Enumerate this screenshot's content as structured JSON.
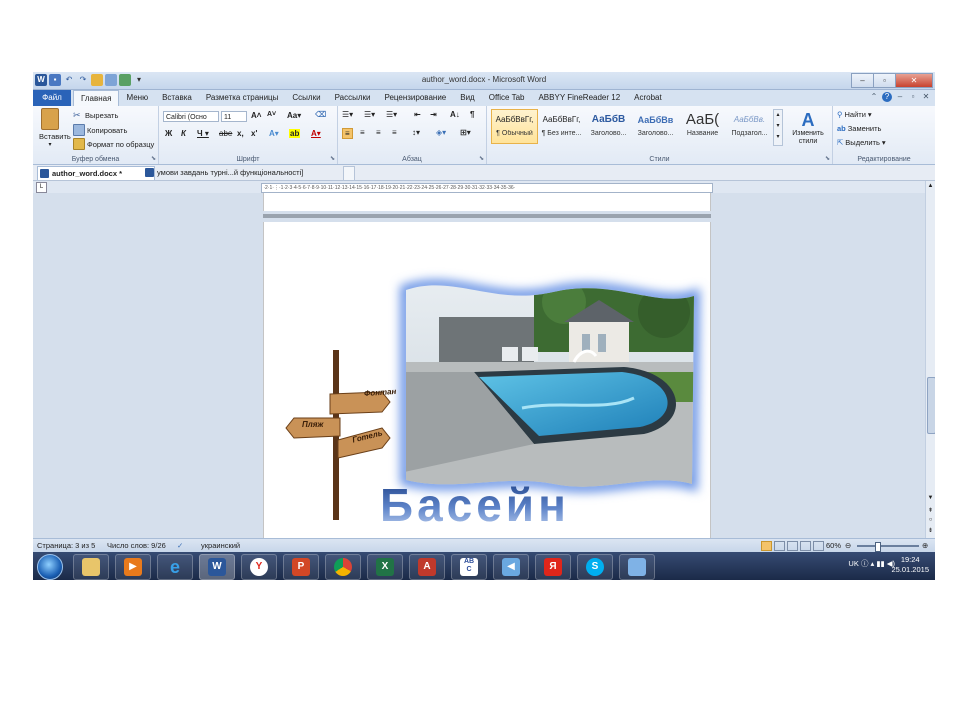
{
  "window": {
    "title": "author_word.docx - Microsoft Word",
    "quick_access_icons": [
      "word-logo",
      "save-icon",
      "undo-icon",
      "redo-icon",
      "misc-icon"
    ]
  },
  "ribbon_tabs": {
    "file": "Файл",
    "tabs": [
      "Главная",
      "Меню",
      "Вставка",
      "Разметка страницы",
      "Ссылки",
      "Рассылки",
      "Рецензирование",
      "Вид",
      "Office Tab",
      "ABBYY FineReader 12",
      "Acrobat"
    ],
    "active_index": 0
  },
  "clipboard": {
    "paste": "Вставить",
    "cut": "Вырезать",
    "copy": "Копировать",
    "format_painter": "Формат по образцу",
    "label": "Буфер обмена"
  },
  "font": {
    "name": "Calibri (Осно",
    "size": "11",
    "label": "Шрифт"
  },
  "paragraph": {
    "label": "Абзац"
  },
  "styles": {
    "label": "Стили",
    "items": [
      {
        "preview": "АаБбВвГг,",
        "name": "¶ Обычный"
      },
      {
        "preview": "АаБбВвГг,",
        "name": "¶ Без инте..."
      },
      {
        "preview": "АаБбВ",
        "name": "Заголово..."
      },
      {
        "preview": "АаБбВв",
        "name": "Заголово..."
      },
      {
        "preview": "АаБ(",
        "name": "Название"
      },
      {
        "preview": "АаБбВв.",
        "name": "Подзагол..."
      }
    ],
    "change": "Изменить стили"
  },
  "editing": {
    "find": "Найти",
    "replace": "Заменить",
    "select": "Выделить",
    "label": "Редактирование"
  },
  "doc_tabs": [
    {
      "label": "author_word.docx *"
    },
    {
      "label": "умови завдань турні...й функціональності]"
    }
  ],
  "document": {
    "wordart": "Басейн",
    "signpost": [
      "Фонтан",
      "Пляж",
      "Готель"
    ]
  },
  "status": {
    "page": "Страница: 3 из 5",
    "words": "Число слов: 9/26",
    "lang": "украинский",
    "zoom": "60%"
  },
  "tray": {
    "lang": "UK",
    "time": "19:24",
    "date": "25.01.2015"
  }
}
